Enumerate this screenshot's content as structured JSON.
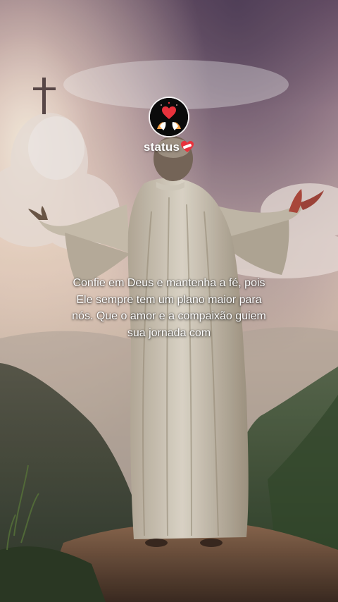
{
  "profile": {
    "icon": "heart-hands-avatar-icon",
    "accent_color": "#e8323c"
  },
  "status": {
    "label": "status",
    "emoji_icon": "mending-heart-icon"
  },
  "caption": {
    "lines": [
      "Confie em Deus e mantenha a fé, pois",
      "Ele sempre tem um plano maior para",
      "nós. Que o amor e a compaixão guiem",
      "sua jornada com"
    ]
  },
  "background": {
    "subject": "robed-figure-with-open-arms-icon",
    "cross": "cross-icon"
  }
}
